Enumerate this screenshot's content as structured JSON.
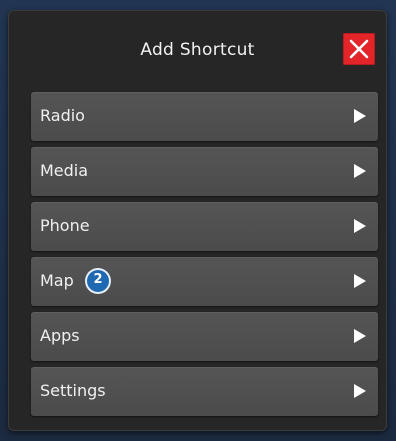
{
  "dialog": {
    "title": "Add Shortcut",
    "close_icon": "close-icon",
    "colors": {
      "close": "#e3252a",
      "row": "#505050",
      "badge": "#1f69b3"
    }
  },
  "menu": {
    "items": [
      {
        "label": "Radio",
        "icon": "chevron-right-icon"
      },
      {
        "label": "Media",
        "icon": "chevron-right-icon"
      },
      {
        "label": "Phone",
        "icon": "chevron-right-icon"
      },
      {
        "label": "Map",
        "badge": "2",
        "icon": "chevron-right-icon"
      },
      {
        "label": "Apps",
        "icon": "chevron-right-icon"
      },
      {
        "label": "Settings",
        "icon": "chevron-right-icon"
      }
    ]
  }
}
